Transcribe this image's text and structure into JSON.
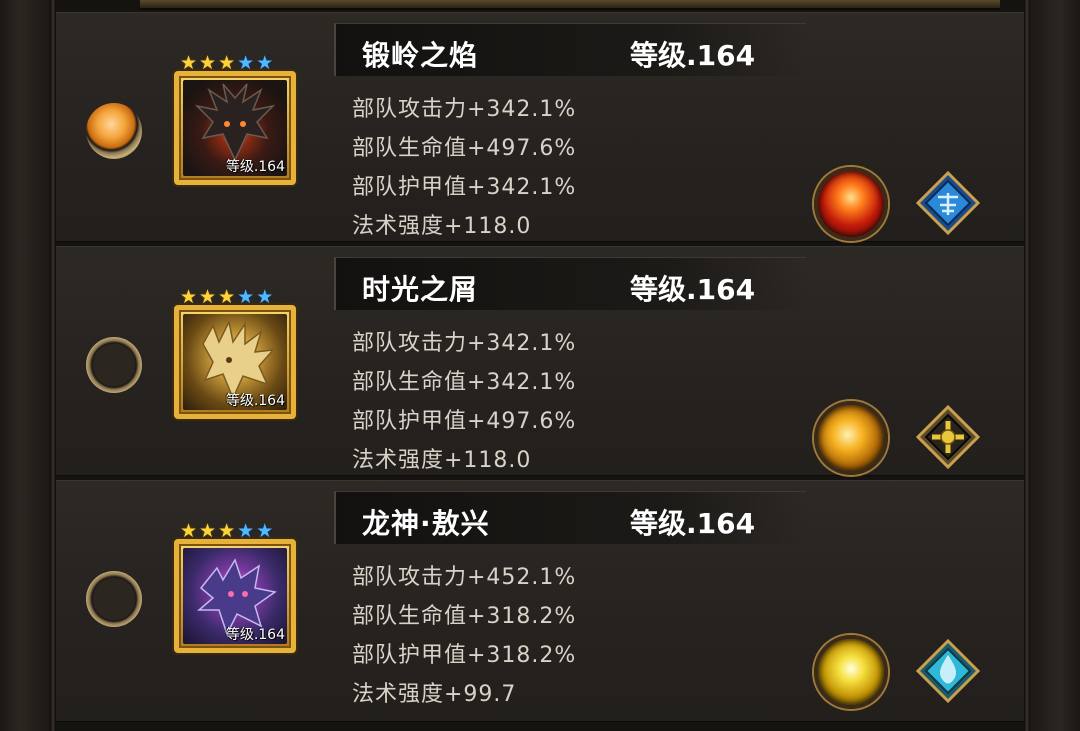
{
  "heroes": [
    {
      "name": "锻岭之焰",
      "level_label": "等级.164",
      "portrait_level": "等级.164",
      "selected": true,
      "stars": {
        "gold": 3,
        "blue": 2
      },
      "stats": [
        "部队攻击力+342.1%",
        "部队生命值+497.6%",
        "部队护甲值+342.1%",
        "法术强度+118.0"
      ],
      "skill_icon": "fire-pillar-skill-icon",
      "class_icon": "blue-rune-class-icon",
      "theme_colors": {
        "portrait": "#6a2a18",
        "skill": "#e2401a",
        "class": "#2a8ad8"
      }
    },
    {
      "name": "时光之屑",
      "level_label": "等级.164",
      "portrait_level": "等级.164",
      "selected": false,
      "stars": {
        "gold": 3,
        "blue": 2
      },
      "stats": [
        "部队攻击力+342.1%",
        "部队生命值+342.1%",
        "部队护甲值+497.6%",
        "法术强度+118.0"
      ],
      "skill_icon": "golden-vortex-skill-icon",
      "class_icon": "gold-cross-class-icon",
      "theme_colors": {
        "portrait": "#8a6a20",
        "skill": "#f0a010",
        "class": "#d8b030"
      }
    },
    {
      "name": "龙神·敖兴",
      "level_label": "等级.164",
      "portrait_level": "等级.164",
      "selected": false,
      "stars": {
        "gold": 3,
        "blue": 2
      },
      "stats": [
        "部队攻击力+452.1%",
        "部队生命值+318.2%",
        "部队护甲值+318.2%",
        "法术强度+99.7"
      ],
      "skill_icon": "lightning-orb-skill-icon",
      "class_icon": "cyan-drop-class-icon",
      "theme_colors": {
        "portrait": "#4a2a6a",
        "skill": "#f4d020",
        "class": "#30b8d8"
      }
    }
  ]
}
